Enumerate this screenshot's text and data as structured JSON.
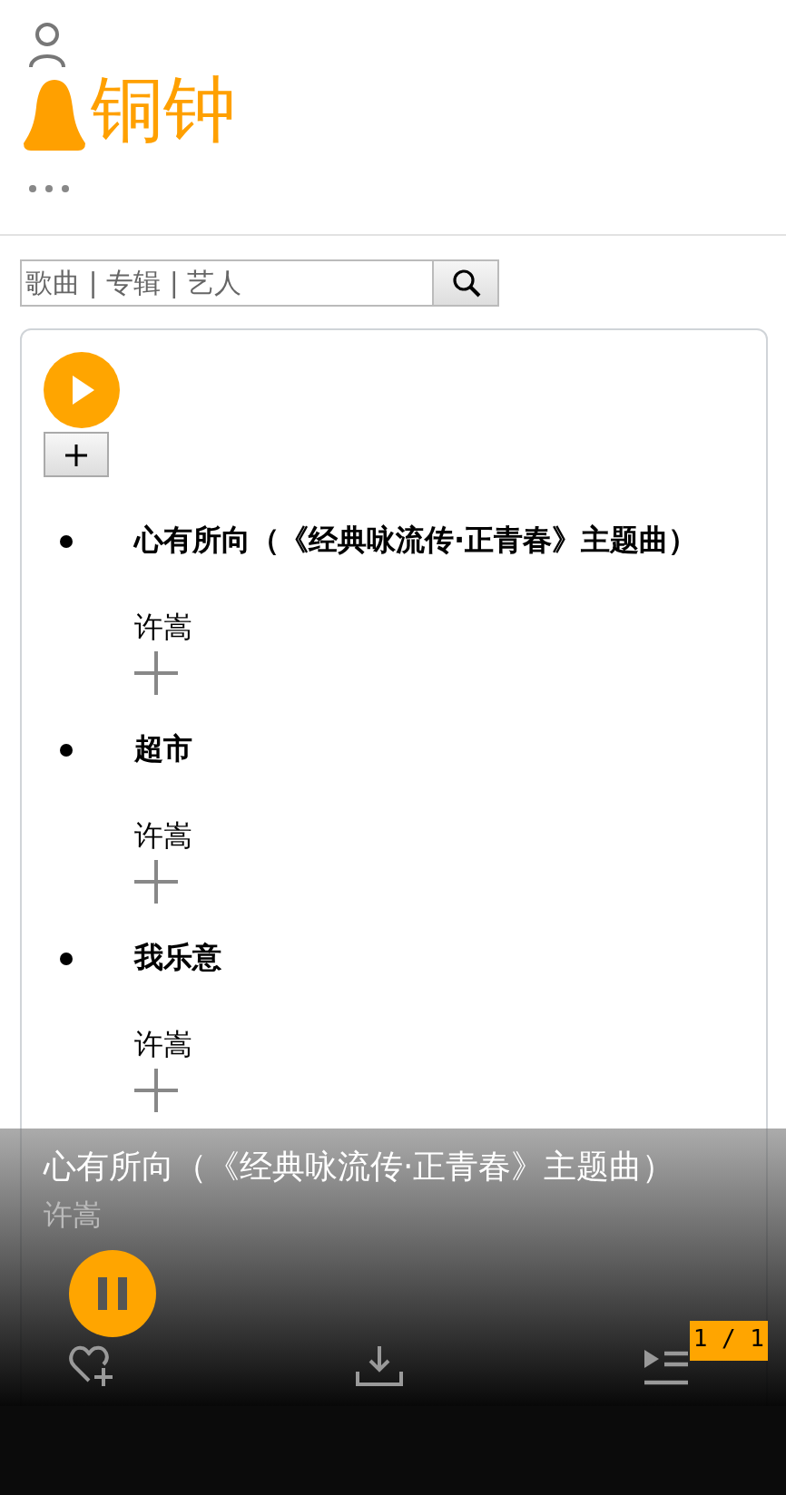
{
  "header": {
    "app_name": "铜钟"
  },
  "search": {
    "placeholder": "歌曲 | 专辑 | 艺人"
  },
  "songs": [
    {
      "title": "心有所向（《经典咏流传·正青春》主题曲）",
      "artist": "许嵩"
    },
    {
      "title": "超市",
      "artist": "许嵩"
    },
    {
      "title": "我乐意",
      "artist": "许嵩"
    }
  ],
  "player": {
    "title": "心有所向（《经典咏流传·正青春》主题曲）",
    "artist": "许嵩",
    "playing": true,
    "queue_position": "1 / 1"
  }
}
